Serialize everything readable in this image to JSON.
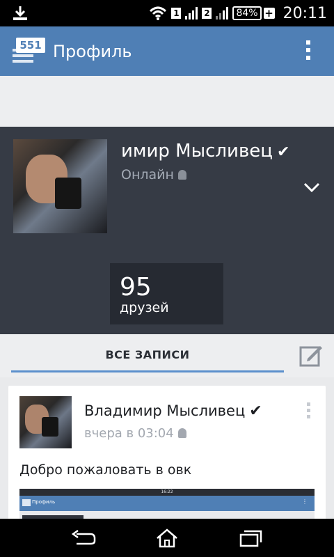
{
  "status_bar": {
    "sim1": "1",
    "sim2": "2",
    "battery": "84%",
    "time": "20:11"
  },
  "app_bar": {
    "badge": "551",
    "title": "Профиль"
  },
  "profile": {
    "name": "имир Мысливец",
    "status": "Онлайн",
    "friends_count": "95",
    "friends_label": "друзей"
  },
  "tabs": {
    "all_posts": "ВСЕ ЗАПИСИ"
  },
  "post": {
    "author": "Владимир Мысливец",
    "time": "вчера в 03:04",
    "text": "Добро пожаловать в овк",
    "image": {
      "mini_time": "16:22",
      "mini_title": "Профиль"
    }
  },
  "colors": {
    "app_bar": "#4f7fb5",
    "header_bg": "#363b45",
    "tab_underline": "#5b8fcc"
  },
  "icons": {
    "status_left": "download-icon",
    "status_right": [
      "wifi-icon",
      "signal-icon",
      "battery-icon"
    ],
    "app_bar": [
      "menu-icon",
      "overflow-icon"
    ],
    "profile": [
      "verified-icon",
      "android-icon",
      "chevron-down-icon"
    ],
    "tabs": [
      "edit-icon"
    ],
    "nav": [
      "back-icon",
      "home-icon",
      "recent-apps-icon"
    ]
  }
}
